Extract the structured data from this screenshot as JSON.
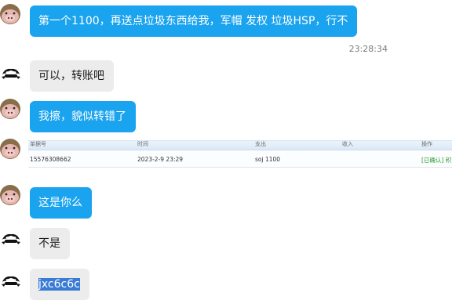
{
  "messages": [
    {
      "sender": "peer",
      "avatar": "pig-avatar",
      "text": "第一个1100，再送点垃圾东西给我，军帽 发权 垃圾HSP，行不"
    },
    {
      "timestamp": "23:28:34"
    },
    {
      "sender": "me",
      "avatar": "bear-avatar",
      "text": "可以，转账吧"
    },
    {
      "sender": "peer",
      "avatar": "pig-avatar",
      "text": "我擦，貌似转错了"
    },
    {
      "sender": "peer",
      "avatar": "pig-avatar",
      "type": "image",
      "image": {
        "headers": [
          "单据号",
          "时间",
          "支出",
          "收入",
          "操作"
        ],
        "row": {
          "id": "15576308662",
          "time": "2023-2-9 23:29",
          "amount": "soj 1100",
          "income": "",
          "action": "[已确认] 积"
        }
      }
    },
    {
      "sender": "peer",
      "avatar": "pig-avatar",
      "text": "这是你么"
    },
    {
      "sender": "me",
      "avatar": "bear-avatar",
      "text": "不是"
    },
    {
      "sender": "me",
      "avatar": "bear-avatar",
      "text": "jxc6c6c"
    }
  ],
  "colors": {
    "peer_bubble": "#1aa3ee",
    "me_bubble": "#ececec",
    "selection": "#3a7bd5"
  }
}
